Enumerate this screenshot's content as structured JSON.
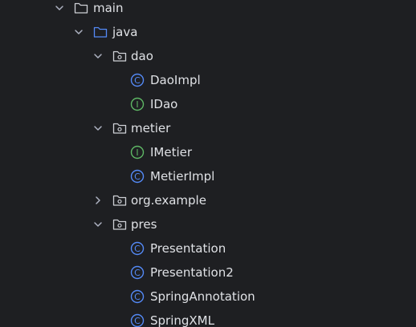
{
  "project_tree": {
    "items": [
      {
        "label": "main",
        "kind": "folder",
        "expanded": true
      },
      {
        "label": "java",
        "kind": "source-folder",
        "expanded": true
      },
      {
        "label": "dao",
        "kind": "package",
        "expanded": true
      },
      {
        "label": "DaoImpl",
        "kind": "class",
        "icon_letter": "C"
      },
      {
        "label": "IDao",
        "kind": "interface",
        "icon_letter": "I"
      },
      {
        "label": "metier",
        "kind": "package",
        "expanded": true
      },
      {
        "label": "IMetier",
        "kind": "interface",
        "icon_letter": "I"
      },
      {
        "label": "MetierImpl",
        "kind": "class",
        "icon_letter": "C"
      },
      {
        "label": "org.example",
        "kind": "package",
        "expanded": false
      },
      {
        "label": "pres",
        "kind": "package",
        "expanded": true
      },
      {
        "label": "Presentation",
        "kind": "class",
        "icon_letter": "C"
      },
      {
        "label": "Presentation2",
        "kind": "class",
        "icon_letter": "C"
      },
      {
        "label": "SpringAnnotation",
        "kind": "class",
        "icon_letter": "C"
      },
      {
        "label": "SpringXML",
        "kind": "class",
        "icon_letter": "C"
      }
    ]
  },
  "colors": {
    "background": "#1e1f22",
    "text": "#dfe1e5",
    "chevron": "#aeb3c2",
    "folder_outline": "#ced0d6",
    "source_folder_outline": "#548af7",
    "class_icon": "#548af7",
    "interface_icon": "#5fb865"
  }
}
